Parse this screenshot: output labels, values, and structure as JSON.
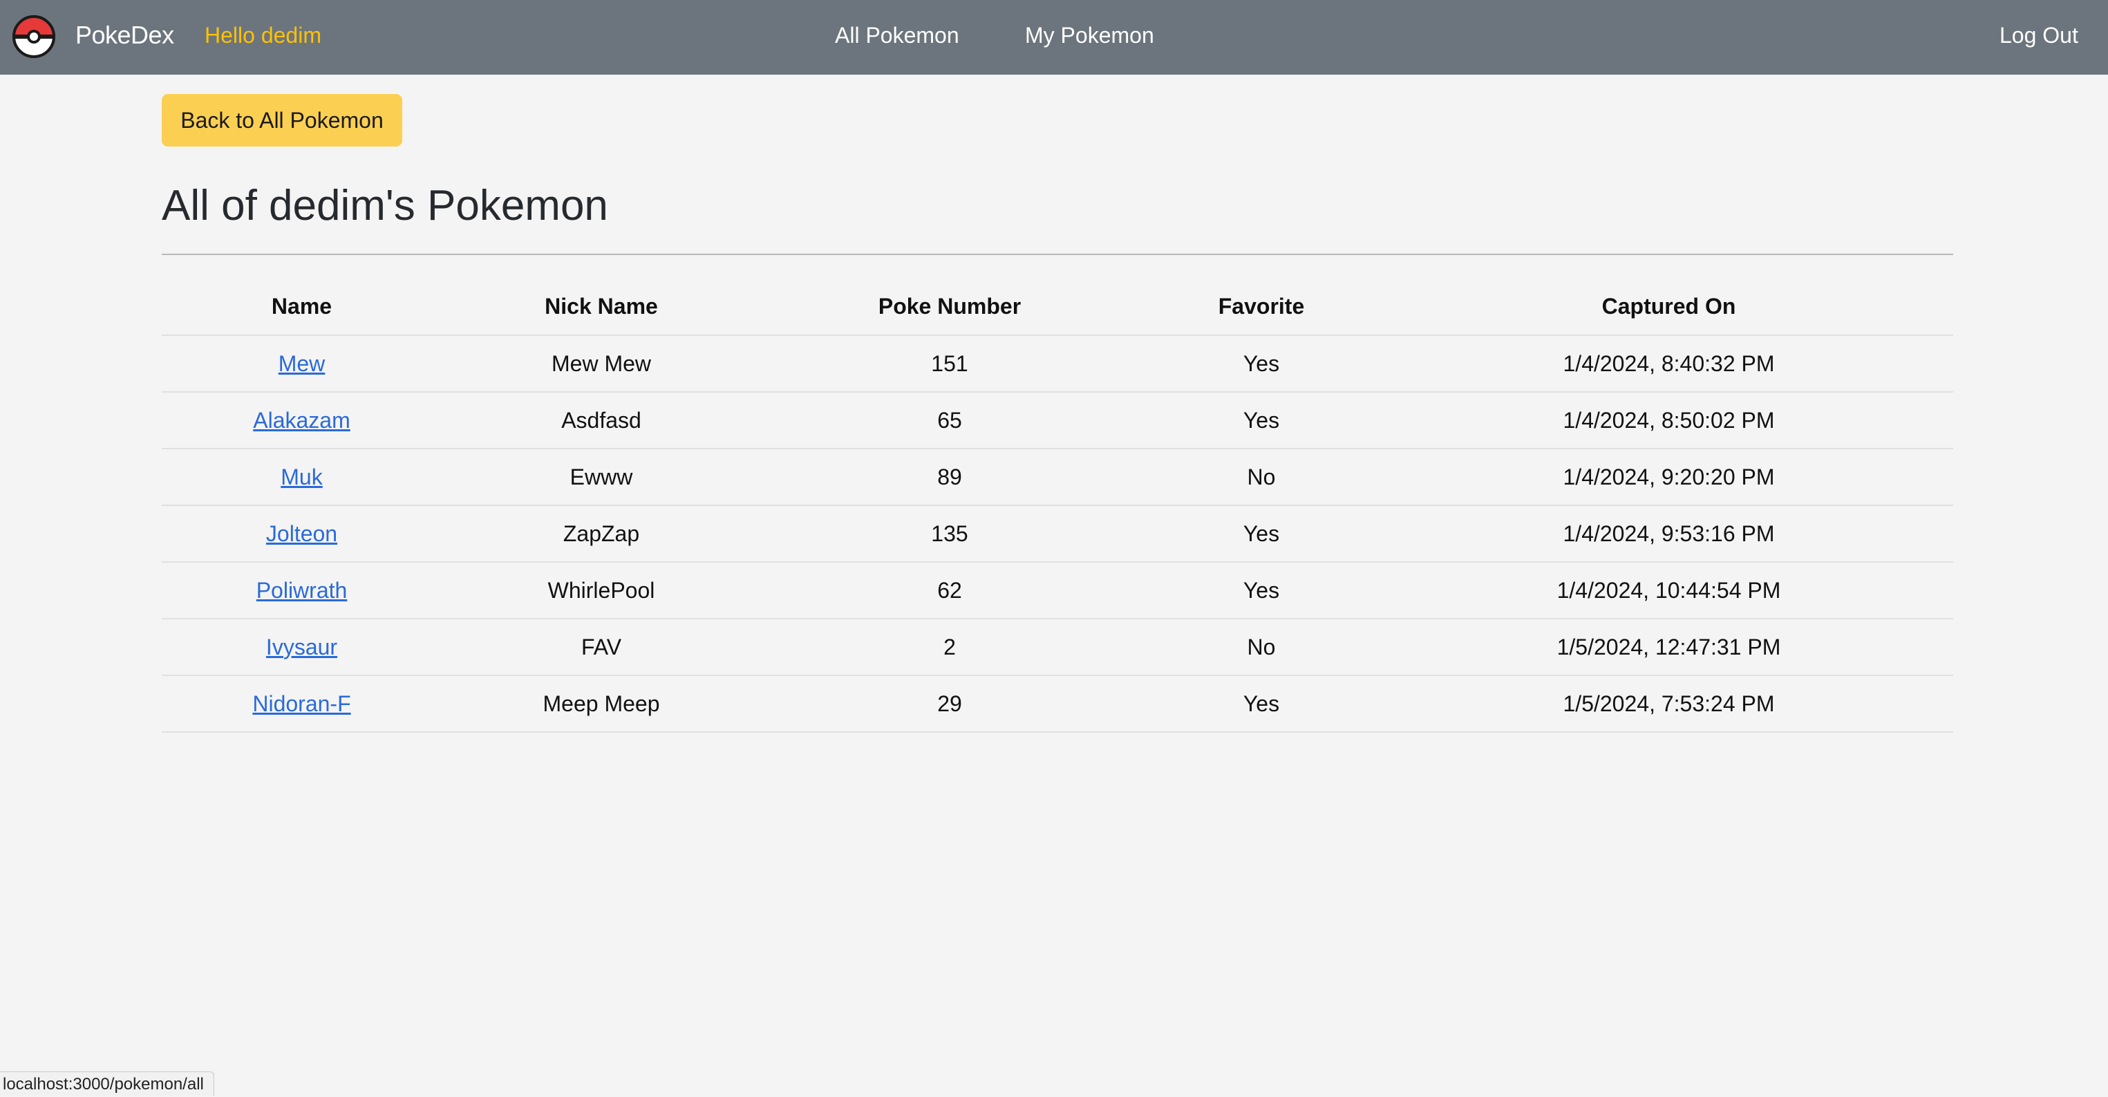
{
  "navbar": {
    "brand": "PokeDex",
    "greeting": "Hello dedim",
    "links": [
      "All Pokemon",
      "My Pokemon"
    ],
    "logout": "Log Out",
    "logo_icon": "pokeball-icon"
  },
  "actions": {
    "back_label": "Back to All Pokemon"
  },
  "page": {
    "title": "All of dedim's Pokemon"
  },
  "table": {
    "headers": [
      "Name",
      "Nick Name",
      "Poke Number",
      "Favorite",
      "Captured On"
    ],
    "rows": [
      {
        "name": "Mew",
        "nickname": "Mew Mew",
        "number": "151",
        "favorite": "Yes",
        "captured": "1/4/2024, 8:40:32 PM"
      },
      {
        "name": "Alakazam",
        "nickname": "Asdfasd",
        "number": "65",
        "favorite": "Yes",
        "captured": "1/4/2024, 8:50:02 PM"
      },
      {
        "name": "Muk",
        "nickname": "Ewww",
        "number": "89",
        "favorite": "No",
        "captured": "1/4/2024, 9:20:20 PM"
      },
      {
        "name": "Jolteon",
        "nickname": "ZapZap",
        "number": "135",
        "favorite": "Yes",
        "captured": "1/4/2024, 9:53:16 PM"
      },
      {
        "name": "Poliwrath",
        "nickname": "WhirlePool",
        "number": "62",
        "favorite": "Yes",
        "captured": "1/4/2024, 10:44:54 PM"
      },
      {
        "name": "Ivysaur",
        "nickname": "FAV",
        "number": "2",
        "favorite": "No",
        "captured": "1/5/2024, 12:47:31 PM"
      },
      {
        "name": "Nidoran-F",
        "nickname": "Meep Meep",
        "number": "29",
        "favorite": "Yes",
        "captured": "1/5/2024, 7:53:24 PM"
      }
    ]
  },
  "status_bar": {
    "url": "localhost:3000/pokemon/all"
  },
  "colors": {
    "navbar": "#6c757d",
    "greeting": "#ffc107",
    "button": "#fbcf52",
    "link": "#2a6ad9",
    "background": "#f4f4f4"
  }
}
